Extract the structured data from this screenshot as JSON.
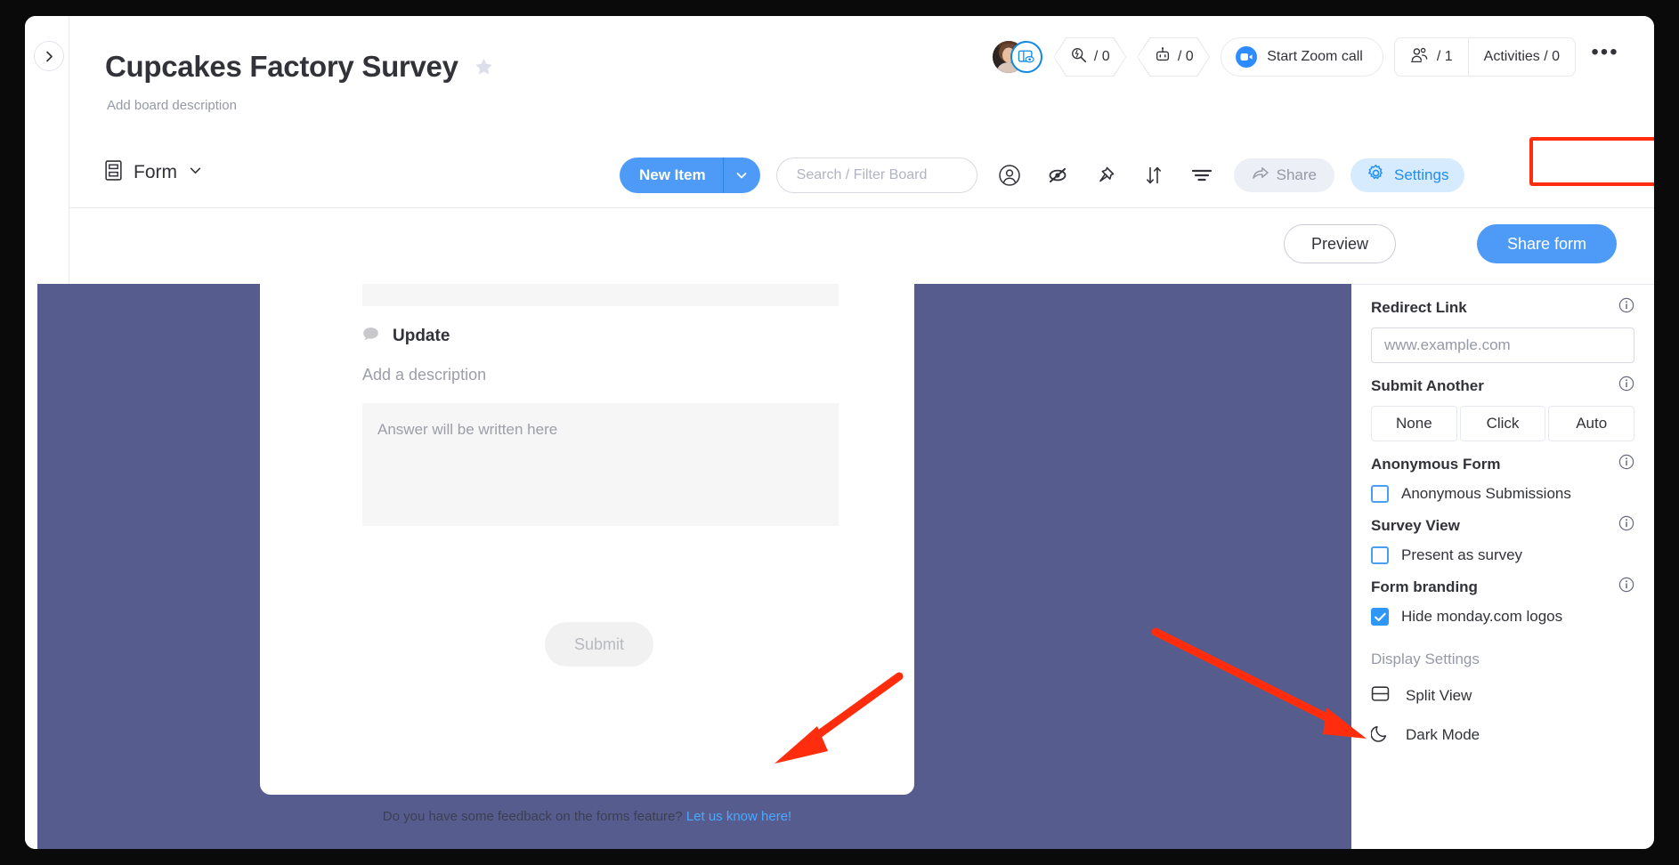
{
  "window": {
    "sidebar_toggle_icon": "chevron-right-icon"
  },
  "header": {
    "board_title": "Cupcakes Factory Survey",
    "favorite_icon": "star-icon",
    "board_description": "Add board description",
    "avatar": "user-avatar",
    "avatar_badge_icon": "board-view-eye-icon",
    "chips": [
      {
        "icon": "bolt-search-icon",
        "label": "/ 0"
      },
      {
        "icon": "robot-icon",
        "label": "/ 0"
      }
    ],
    "zoom_button": {
      "icon": "zoom-camera-icon",
      "label": "Start Zoom call"
    },
    "members": {
      "icon": "people-icon",
      "label": "/ 1"
    },
    "activities": {
      "label": "Activities / 0"
    },
    "more_menu": "•••"
  },
  "toolbar": {
    "view_icon": "form-view-icon",
    "view_label": "Form",
    "view_caret_icon": "chevron-down-icon",
    "new_item_label": "New Item",
    "new_item_caret_icon": "chevron-down-icon",
    "search_placeholder": "Search / Filter Board",
    "search_value": "",
    "icons": [
      "person-circle-icon",
      "eye-off-icon",
      "pin-icon",
      "sort-icon",
      "filter-icon"
    ],
    "share_label": "Share",
    "share_icon": "share-arrow-icon",
    "settings_label": "Settings",
    "settings_icon": "gear-icon"
  },
  "form_actions": {
    "preview_label": "Preview",
    "share_form_label": "Share form"
  },
  "form": {
    "question_icon": "speech-bubble-icon",
    "question_title": "Update",
    "question_description": "Add a description",
    "answer_placeholder": "Answer will be written here",
    "submit_label": "Submit",
    "footer_text": "Do you have some feedback on the forms feature?",
    "footer_link": "Let us know here!"
  },
  "settings_panel": {
    "redirect_link": {
      "label": "Redirect Link",
      "info_icon": "info-icon",
      "placeholder": "www.example.com",
      "value": ""
    },
    "submit_another": {
      "label": "Submit Another",
      "info_icon": "info-icon",
      "options": [
        "None",
        "Click",
        "Auto"
      ]
    },
    "anonymous_form": {
      "label": "Anonymous Form",
      "info_icon": "info-icon",
      "checkbox_label": "Anonymous Submissions",
      "checked": false
    },
    "survey_view": {
      "label": "Survey View",
      "info_icon": "info-icon",
      "checkbox_label": "Present as survey",
      "checked": false
    },
    "form_branding": {
      "label": "Form branding",
      "info_icon": "info-icon",
      "checkbox_label": "Hide monday.com logos",
      "checked": true
    },
    "display_settings": {
      "label": "Display Settings",
      "items": [
        {
          "icon": "split-view-icon",
          "label": "Split View"
        },
        {
          "icon": "moon-icon",
          "label": "Dark Mode"
        }
      ]
    }
  },
  "colors": {
    "accent_blue": "#4D9BF7",
    "settings_blue": "#1f8ded",
    "board_purple": "#565C8E",
    "annotation_red": "#FF2D0E"
  }
}
